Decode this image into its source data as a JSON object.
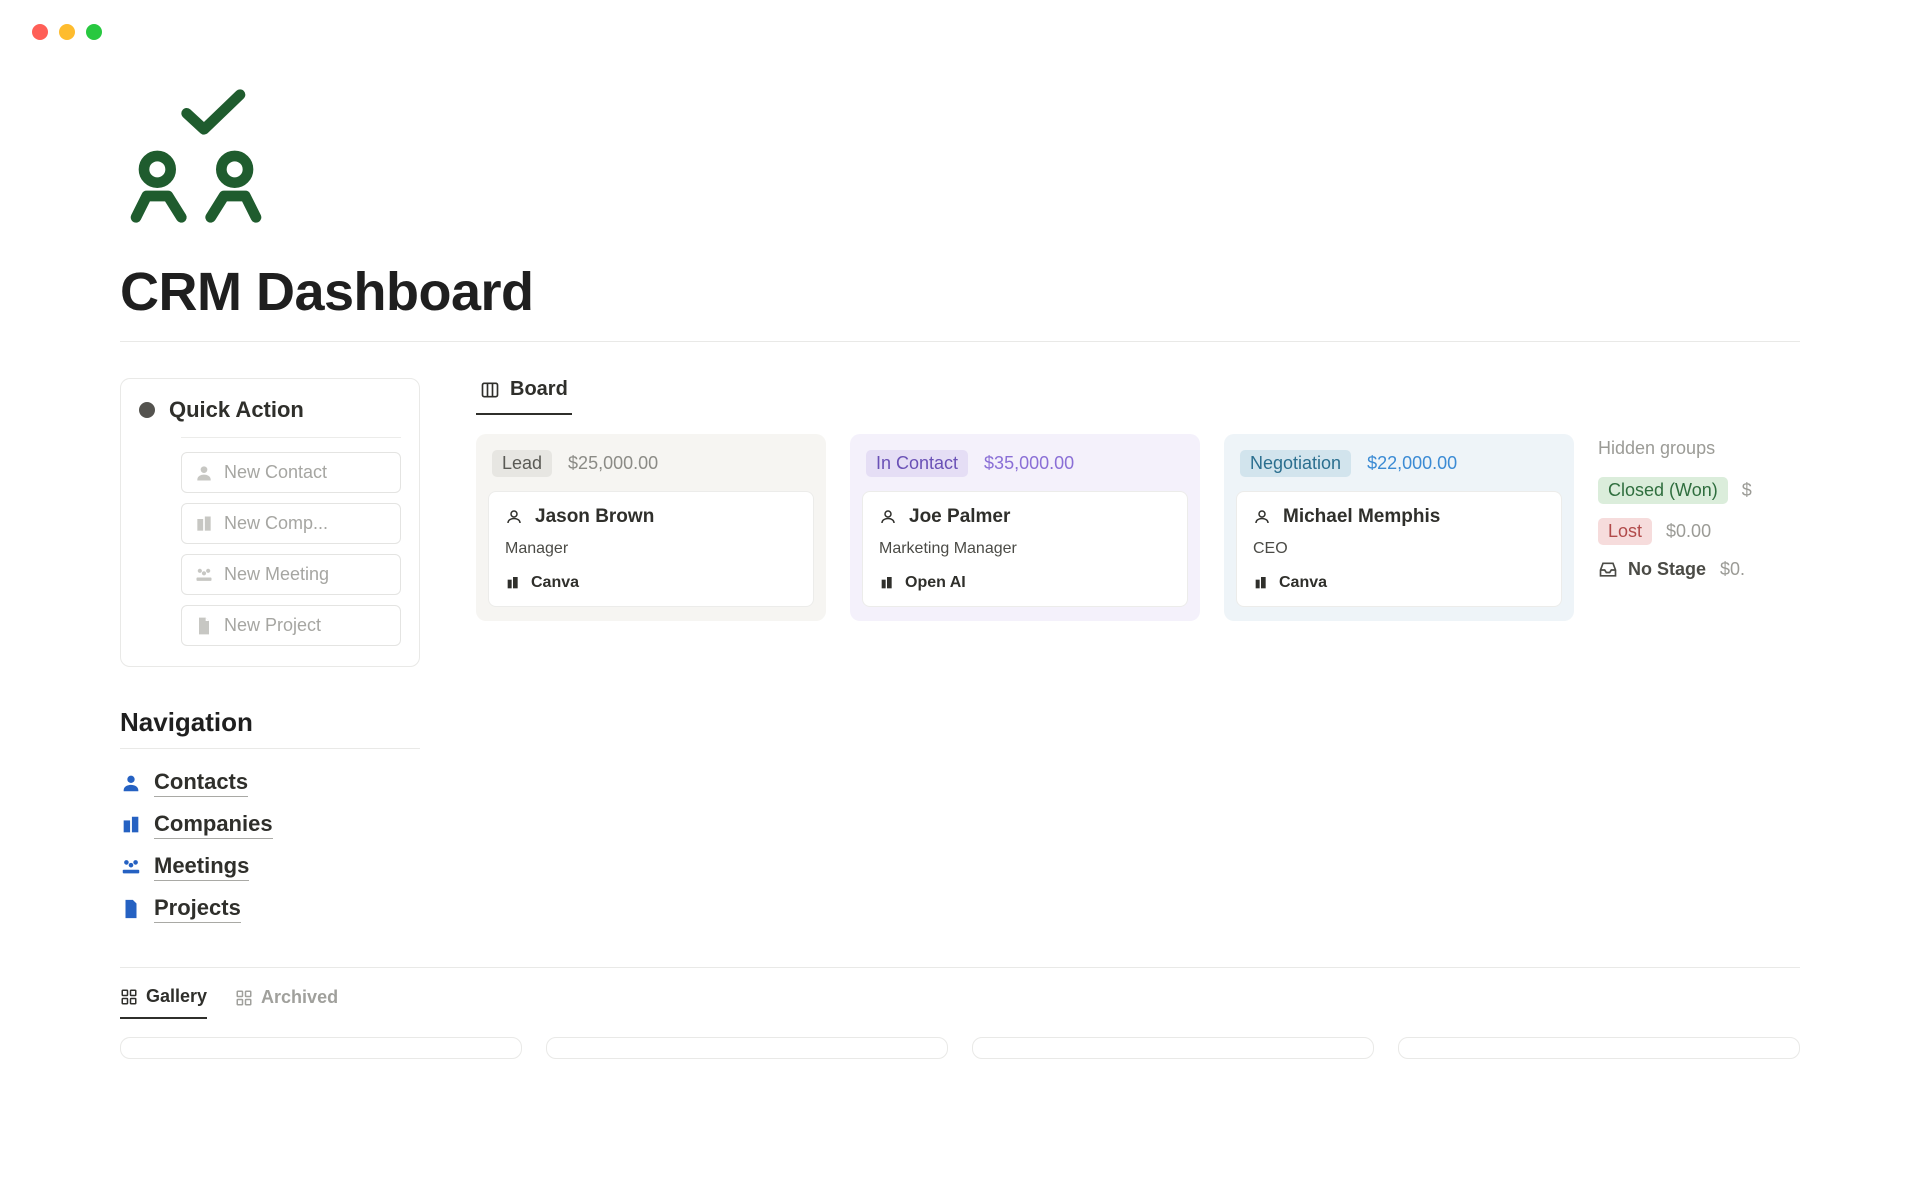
{
  "page": {
    "title": "CRM Dashboard"
  },
  "quick_action": {
    "title": "Quick Action",
    "items": [
      {
        "label": "New Contact"
      },
      {
        "label": "New Comp..."
      },
      {
        "label": "New Meeting"
      },
      {
        "label": "New Project"
      }
    ]
  },
  "navigation": {
    "title": "Navigation",
    "items": [
      {
        "label": "Contacts"
      },
      {
        "label": "Companies"
      },
      {
        "label": "Meetings"
      },
      {
        "label": "Projects"
      }
    ]
  },
  "board": {
    "tab_label": "Board",
    "columns": [
      {
        "stage": "Lead",
        "amount": "$25,000.00",
        "cards": [
          {
            "name": "Jason Brown",
            "role": "Manager",
            "company": "Canva"
          }
        ]
      },
      {
        "stage": "In Contact",
        "amount": "$35,000.00",
        "cards": [
          {
            "name": "Joe Palmer",
            "role": "Marketing Manager",
            "company": "Open AI"
          }
        ]
      },
      {
        "stage": "Negotiation",
        "amount": "$22,000.00",
        "cards": [
          {
            "name": "Michael Memphis",
            "role": "CEO",
            "company": "Canva"
          }
        ]
      }
    ],
    "hidden": {
      "title": "Hidden groups",
      "groups": [
        {
          "label": "Closed (Won)",
          "amount": "$"
        },
        {
          "label": "Lost",
          "amount": "$0.00"
        },
        {
          "label": "No Stage",
          "amount": "$0."
        }
      ]
    }
  },
  "bottom_tabs": {
    "gallery": "Gallery",
    "archived": "Archived"
  }
}
